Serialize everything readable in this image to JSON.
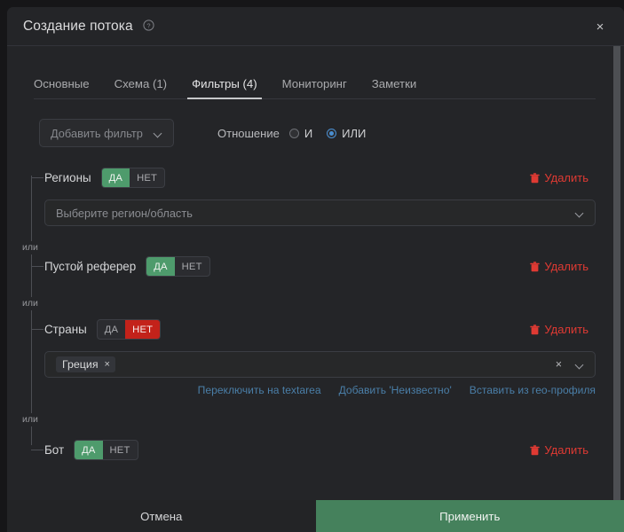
{
  "window": {
    "title": "Создание потока",
    "help_icon": "question-circle-icon",
    "close_icon": "×"
  },
  "tabs": [
    {
      "label": "Основные",
      "active": false
    },
    {
      "label": "Схема (1)",
      "active": false
    },
    {
      "label": "Фильтры (4)",
      "active": true
    },
    {
      "label": "Мониторинг",
      "active": false
    },
    {
      "label": "Заметки",
      "active": false
    }
  ],
  "controls": {
    "add_filter": {
      "label": "Добавить фильтр",
      "icon": "chevron-down-icon"
    },
    "relation": {
      "label": "Отношение",
      "options": [
        {
          "label": "И",
          "selected": false
        },
        {
          "label": "ИЛИ",
          "selected": true
        }
      ],
      "selected": "ИЛИ"
    }
  },
  "connector_label": "или",
  "yes_label": "ДА",
  "no_label": "НЕТ",
  "delete_label": "Удалить",
  "delete_icon": "trash-icon",
  "filters": [
    {
      "name": "Регионы",
      "state": "yes",
      "field": {
        "type": "select",
        "placeholder": "Выберите регион/область",
        "icon": "chevron-down-icon"
      }
    },
    {
      "name": "Пустой реферер",
      "state": "yes",
      "field": null
    },
    {
      "name": "Страны",
      "state": "no",
      "field": {
        "type": "tags",
        "tags": [
          "Греция"
        ],
        "clear_icon": "×",
        "icon": "chevron-down-icon"
      },
      "helper_links": [
        "Переключить на textarea",
        "Добавить 'Неизвестно'",
        "Вставить из гео-профиля"
      ]
    },
    {
      "name": "Бот",
      "state": "yes",
      "field": null
    }
  ],
  "footer": {
    "cancel_label": "Отмена",
    "apply_label": "Применить"
  },
  "colors": {
    "accent_green": "#4e9b6c",
    "accent_red": "#c3221a",
    "delete_red": "#df3a33",
    "link_blue": "#4a7ea7",
    "radio_blue": "#4a8ed0",
    "apply_green": "#45815c",
    "modal_bg": "#242528",
    "page_bg": "#161618"
  }
}
